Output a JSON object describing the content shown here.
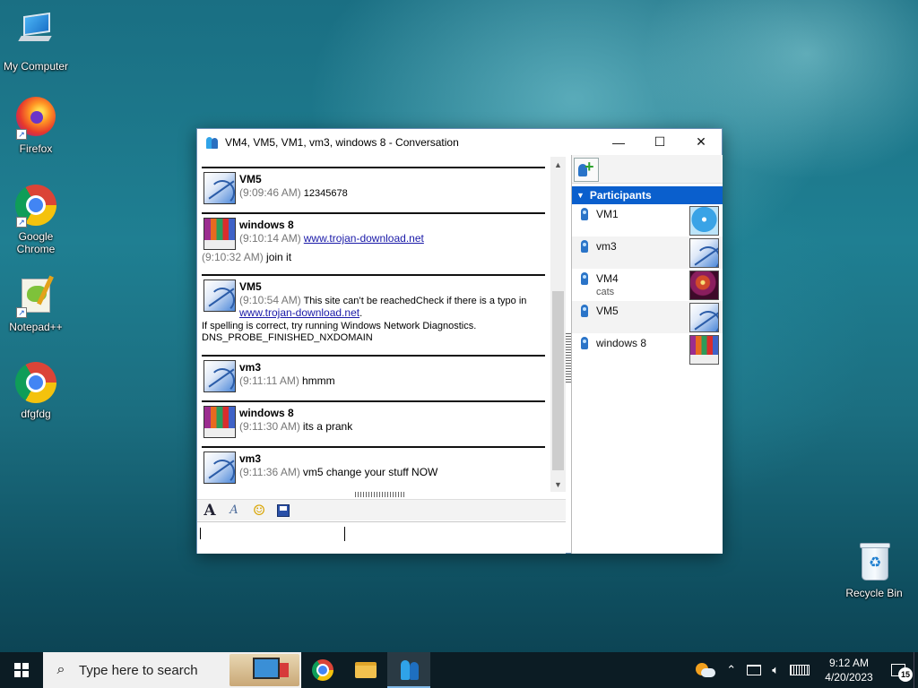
{
  "desktop": {
    "icons": [
      {
        "label": "My Computer"
      },
      {
        "label": "Firefox"
      },
      {
        "label": "Google Chrome"
      },
      {
        "label": "Notepad++"
      },
      {
        "label": "dfgfdg"
      },
      {
        "label": "Recycle Bin"
      }
    ]
  },
  "window": {
    "title": "VM4, VM5, VM1, vm3, windows 8 - Conversation",
    "controls": {
      "minimize": "—",
      "maximize": "☐",
      "close": "✕"
    }
  },
  "messages": [
    {
      "sender": "VM5",
      "time": "(9:09:46 AM)",
      "text": "12345678"
    },
    {
      "sender": "windows 8",
      "time": "(9:10:14 AM)",
      "link": "www.trojan-download.net",
      "extra_time": "(9:10:32 AM)",
      "extra_text": "join it"
    },
    {
      "sender": "VM5",
      "time": "(9:10:54 AM)",
      "text": "This site can’t be reachedCheck if there is a typo in",
      "link": "www.trojan-download.net",
      "link_suffix": ".",
      "line3": "If spelling is correct, try running Windows Network Diagnostics.",
      "line4": "DNS_PROBE_FINISHED_NXDOMAIN"
    },
    {
      "sender": "vm3",
      "time": "(9:11:11 AM)",
      "text": "hmmm"
    },
    {
      "sender": "windows 8",
      "time": "(9:11:30 AM)",
      "text": "its a prank"
    },
    {
      "sender": "vm3",
      "time": "(9:11:36 AM)",
      "text": "vm5 change your stuff NOW"
    }
  ],
  "participants": {
    "header": "Participants",
    "list": [
      {
        "name": "VM1",
        "status": ""
      },
      {
        "name": "vm3",
        "status": ""
      },
      {
        "name": "VM4",
        "status": "cats"
      },
      {
        "name": "VM5",
        "status": ""
      },
      {
        "name": "windows 8",
        "status": ""
      }
    ]
  },
  "format_toolbar": {
    "font": "A",
    "style": "A",
    "smile": "☺"
  },
  "taskbar": {
    "search_placeholder": "Type here to search",
    "clock_time": "9:12 AM",
    "clock_date": "4/20/2023",
    "notification_count": "15"
  }
}
